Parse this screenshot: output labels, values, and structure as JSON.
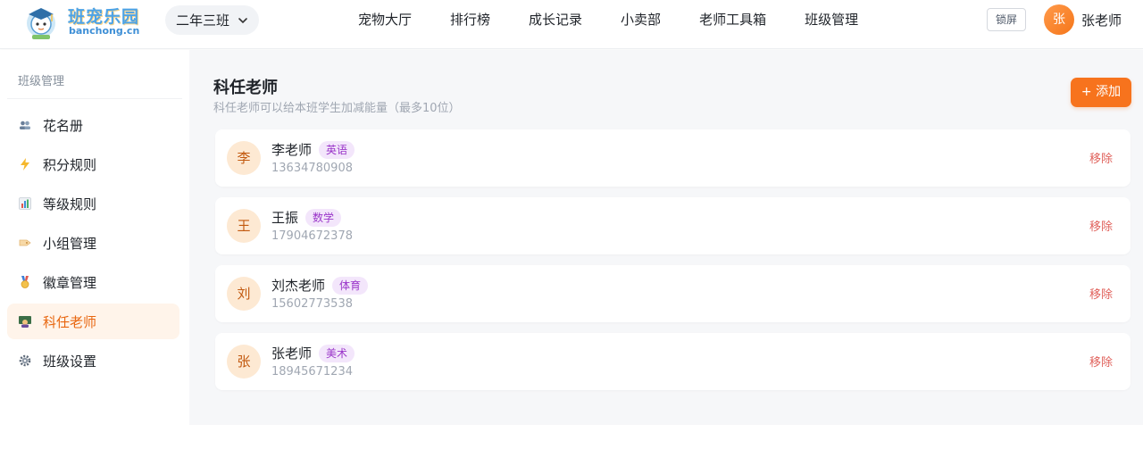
{
  "app": {
    "logo_title": "班宠乐园",
    "logo_sub": "banchong.cn"
  },
  "header": {
    "class_select": "二年三班",
    "nav": [
      "宠物大厅",
      "排行榜",
      "成长记录",
      "小卖部",
      "老师工具箱",
      "班级管理"
    ],
    "lock_label": "锁屏",
    "user_avatar": "张",
    "user_name": "张老师"
  },
  "sidebar": {
    "title": "班级管理",
    "items": [
      {
        "label": "花名册",
        "icon": "people-icon"
      },
      {
        "label": "积分规则",
        "icon": "lightning-icon"
      },
      {
        "label": "等级规则",
        "icon": "bar-chart-icon"
      },
      {
        "label": "小组管理",
        "icon": "tag-icon"
      },
      {
        "label": "徽章管理",
        "icon": "medal-icon"
      },
      {
        "label": "科任老师",
        "icon": "teacher-icon",
        "active": true
      },
      {
        "label": "班级设置",
        "icon": "gear-icon"
      }
    ]
  },
  "main": {
    "title": "科任老师",
    "subtitle": "科任老师可以给本班学生加减能量（最多10位）",
    "add_label": "+ 添加",
    "remove_label": "移除",
    "teachers": [
      {
        "avatar": "李",
        "name": "李老师",
        "subject": "英语",
        "phone": "13634780908"
      },
      {
        "avatar": "王",
        "name": "王振",
        "subject": "数学",
        "phone": "17904672378"
      },
      {
        "avatar": "刘",
        "name": "刘杰老师",
        "subject": "体育",
        "phone": "15602773538"
      },
      {
        "avatar": "张",
        "name": "张老师",
        "subject": "美术",
        "phone": "18945671234"
      }
    ]
  },
  "colors": {
    "accent": "#f7731d",
    "active_bg": "#fff4ea",
    "subject_tag_bg": "#f3e6fb",
    "subject_tag_text": "#9a35c9",
    "remove_text": "#e0625c"
  }
}
